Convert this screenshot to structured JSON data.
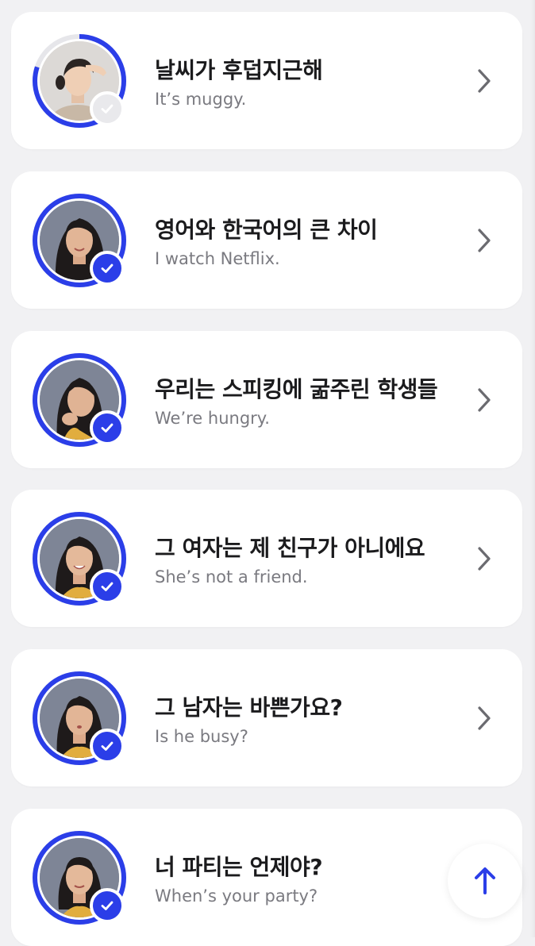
{
  "accent_color": "#2b3ee8",
  "lessons": [
    {
      "title": "날씨가 후덥지근해",
      "subtitle": "It’s muggy.",
      "completed": false,
      "progress": 0.8,
      "check_icon": "check-icon",
      "chevron_icon": "chevron-right-icon"
    },
    {
      "title": "영어와 한국어의 큰 차이",
      "subtitle": "I watch Netflix.",
      "completed": true,
      "progress": 1.0,
      "check_icon": "check-icon",
      "chevron_icon": "chevron-right-icon"
    },
    {
      "title": "우리는 스피킹에 굶주린 학생들",
      "subtitle": "We’re hungry.",
      "completed": true,
      "progress": 1.0,
      "check_icon": "check-icon",
      "chevron_icon": "chevron-right-icon"
    },
    {
      "title": "그 여자는 제 친구가 아니에요",
      "subtitle": "She’s not a friend.",
      "completed": true,
      "progress": 1.0,
      "check_icon": "check-icon",
      "chevron_icon": "chevron-right-icon"
    },
    {
      "title": "그 남자는 바쁜가요?",
      "subtitle": "Is he busy?",
      "completed": true,
      "progress": 1.0,
      "check_icon": "check-icon",
      "chevron_icon": "chevron-right-icon"
    },
    {
      "title": "너 파티는 언제야?",
      "subtitle": "When’s your party?",
      "completed": true,
      "progress": 1.0,
      "check_icon": "check-icon",
      "chevron_icon": "chevron-right-icon"
    }
  ],
  "scroll_top_button": {
    "icon": "arrow-up-icon"
  }
}
